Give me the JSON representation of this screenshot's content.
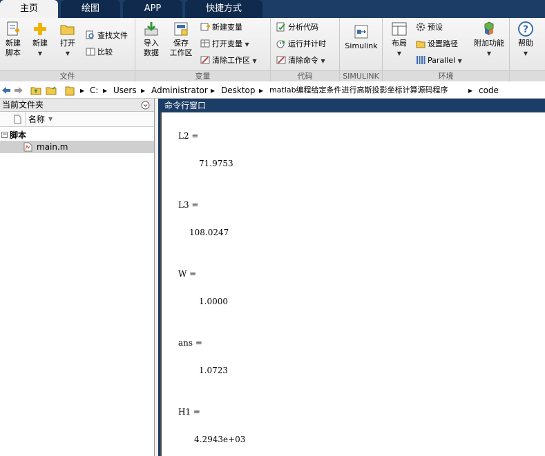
{
  "tabs": [
    {
      "label": "主页"
    },
    {
      "label": "绘图"
    },
    {
      "label": "APP"
    },
    {
      "label": "快捷方式"
    }
  ],
  "ribbon": {
    "file": {
      "label": "文件",
      "new_script": "新建\n脚本",
      "new": "新建",
      "open": "打开",
      "find_files": "查找文件",
      "compare": "比较"
    },
    "variable": {
      "label": "变量",
      "import": "导入\n数据",
      "save_ws": "保存\n工作区",
      "new_var": "新建变量",
      "open_var": "打开变量",
      "clear_ws": "清除工作区"
    },
    "code": {
      "label": "代码",
      "analyze": "分析代码",
      "run_time": "运行并计时",
      "clear_cmd": "清除命令"
    },
    "simulink": {
      "label": "SIMULINK",
      "btn": "Simulink"
    },
    "env": {
      "label": "环境",
      "layout": "布局",
      "prefs": "预设",
      "set_path": "设置路径",
      "parallel": "Parallel",
      "addons": "附加功能"
    },
    "help": {
      "btn": "帮助"
    }
  },
  "address": {
    "parts": [
      "C:",
      "Users",
      "Administrator",
      "Desktop",
      "matlab编程给定条件进行高斯投影坐标计算源码程序",
      "code"
    ]
  },
  "left_panel": {
    "title": "当前文件夹",
    "col_name": "名称",
    "folder": "脚本",
    "file": "main.m"
  },
  "cmd": {
    "title": "命令行窗口",
    "lines": [
      "L2 =",
      "71.9753",
      "L3 =",
      "108.0247",
      "W =",
      "1.0000",
      "ans =",
      "1.0723",
      "H1 =",
      "4.2943e+03"
    ]
  },
  "colors": {
    "accent": "#1c3d66",
    "ribbon_bg": "#e9e9e9",
    "selected_row": "#cfcfcf"
  }
}
